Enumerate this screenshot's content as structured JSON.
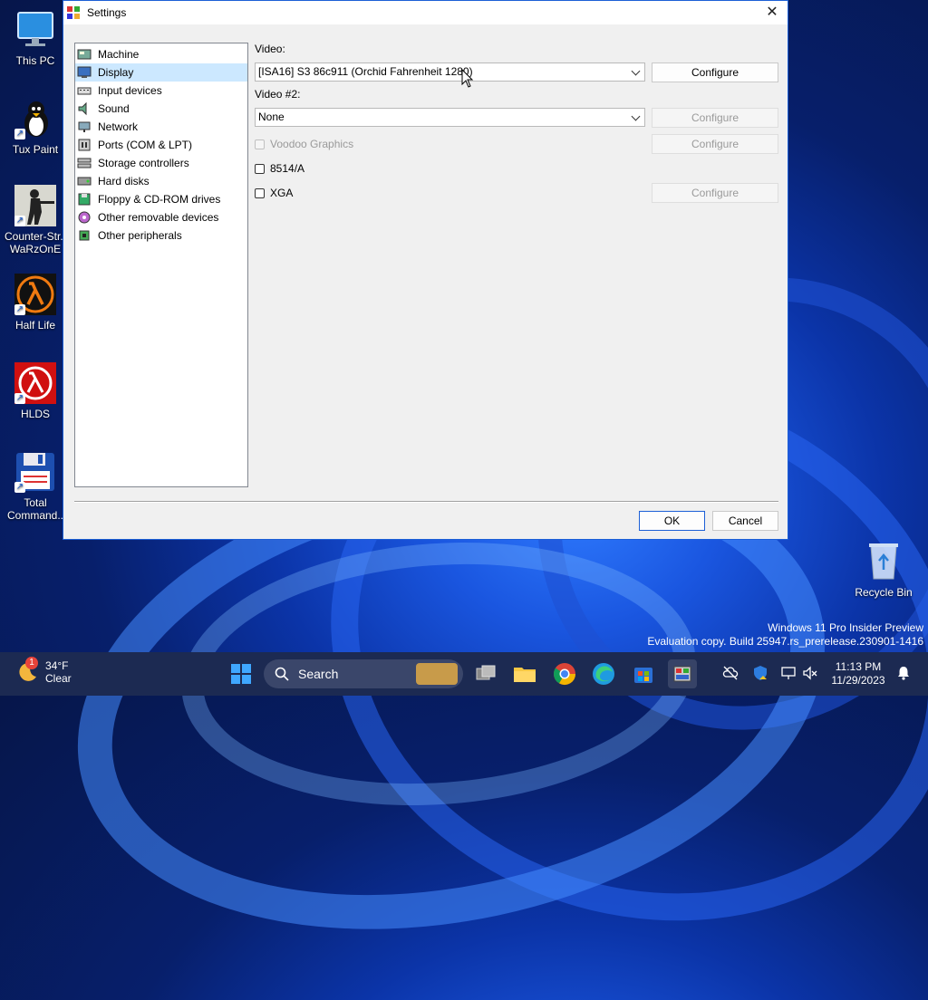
{
  "desktop": {
    "icons": [
      {
        "label": "This PC"
      },
      {
        "label": "Tux Paint"
      },
      {
        "label": "Counter-Str..",
        "label2": "WaRzOnE"
      },
      {
        "label": "Half Life"
      },
      {
        "label": "HLDS"
      },
      {
        "label": "Total",
        "label2": "Command.."
      }
    ],
    "recycle_bin": "Recycle Bin",
    "watermark": {
      "line1": "Windows 11 Pro Insider Preview",
      "line2": "Evaluation copy. Build 25947.rs_prerelease.230901-1416"
    }
  },
  "window": {
    "title": "Settings",
    "close_glyph": "✕",
    "sidebar": {
      "items": [
        {
          "label": "Machine",
          "selected": false
        },
        {
          "label": "Display",
          "selected": true
        },
        {
          "label": "Input devices",
          "selected": false
        },
        {
          "label": "Sound",
          "selected": false
        },
        {
          "label": "Network",
          "selected": false
        },
        {
          "label": "Ports (COM & LPT)",
          "selected": false
        },
        {
          "label": "Storage controllers",
          "selected": false
        },
        {
          "label": "Hard disks",
          "selected": false
        },
        {
          "label": "Floppy & CD-ROM drives",
          "selected": false
        },
        {
          "label": "Other removable devices",
          "selected": false
        },
        {
          "label": "Other peripherals",
          "selected": false
        }
      ]
    },
    "display": {
      "video_label": "Video:",
      "video_value": "[ISA16] S3 86c911 (Orchid Fahrenheit 1280)",
      "video2_label": "Video #2:",
      "video2_value": "None",
      "voodoo_label": "Voodoo Graphics",
      "ibm8514_label": "8514/A",
      "xga_label": "XGA",
      "configure_label": "Configure"
    },
    "ok_label": "OK",
    "cancel_label": "Cancel"
  },
  "taskbar": {
    "weather_temp": "34°F",
    "weather_cond": "Clear",
    "weather_badge": "1",
    "search_label": "Search",
    "time": "11:13 PM",
    "date": "11/29/2023"
  },
  "colors": {
    "accent": "#1c5fd6",
    "selection": "#cce8ff",
    "taskbar": "#1c2a52"
  }
}
